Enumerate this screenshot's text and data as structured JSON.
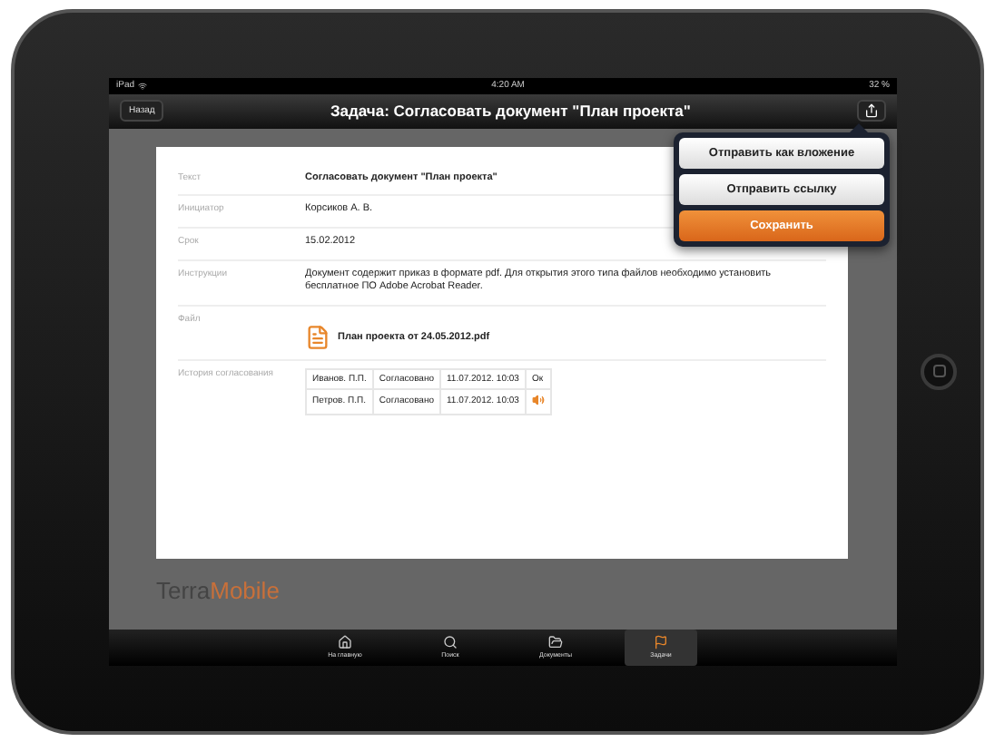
{
  "status_bar": {
    "device": "iPad",
    "time": "4:20 AM",
    "battery": "32 %"
  },
  "nav_bar": {
    "back": "Назад",
    "title": "Задача: Согласовать документ \"План проекта\""
  },
  "share_menu": [
    {
      "label": "Отправить как вложение",
      "kind": "plain"
    },
    {
      "label": "Отправить ссылку",
      "kind": "plain"
    },
    {
      "label": "Сохранить",
      "kind": "primary"
    }
  ],
  "fields": [
    {
      "label": "Текст",
      "kind": "bold",
      "value": "Согласовать документ \"План проекта\""
    },
    {
      "label": "Инициатор",
      "kind": "text",
      "value": "Корсиков А. В."
    },
    {
      "label": "Срок",
      "kind": "text",
      "value": "15.02.2012"
    },
    {
      "label": "Инструкции",
      "kind": "text",
      "value": "Документ содержит приказ в формате pdf. Для открытия этого типа файлов необходимо установить бесплатное ПО Adobe Acrobat Reader."
    },
    {
      "label": "Файл",
      "kind": "file",
      "value": "План проекта от 24.05.2012.pdf"
    },
    {
      "label": "История согласования",
      "kind": "history",
      "rows": [
        {
          "name": "Иванов. П.П.",
          "status": "Согласовано",
          "date": "11.07.2012. 10:03",
          "kind": "text",
          "result": "Ок"
        },
        {
          "name": "Петров. П.П.",
          "status": "Согласовано",
          "date": "11.07.2012. 10:03",
          "kind": "sound"
        }
      ]
    }
  ],
  "logo": {
    "part_1": "Terra",
    "part_2": "Mobile"
  },
  "tab_bar": [
    {
      "label": "На главную",
      "kind": "home",
      "selected": false
    },
    {
      "label": "Поиск",
      "kind": "search",
      "selected": false
    },
    {
      "label": "Документы",
      "kind": "folder",
      "selected": false
    },
    {
      "label": "Задачи",
      "kind": "flag",
      "selected": true
    }
  ]
}
